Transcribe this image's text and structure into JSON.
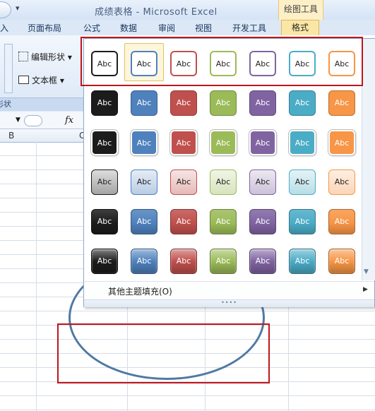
{
  "window": {
    "title": "成绩表格 - Microsoft Excel",
    "context_tab_group": "绘图工具"
  },
  "tabs": [
    "入",
    "页面布局",
    "公式",
    "数据",
    "审阅",
    "视图",
    "开发工具"
  ],
  "active_tab": "格式",
  "ribbon": {
    "edit_shape": "编辑形状",
    "textbox": "文本框",
    "group_label": "形状"
  },
  "formula_bar": {
    "fx": "fx"
  },
  "columns": [
    "B",
    "C"
  ],
  "gallery": {
    "cell_label": "Abc",
    "theme_colors": [
      "#1c1c1c",
      "#4f81bd",
      "#c0504d",
      "#9bbb59",
      "#8064a2",
      "#4bacc6",
      "#f79646"
    ],
    "selected_index": 1,
    "footer_item": "其他主题填充(O)",
    "footer_accel": "O"
  }
}
